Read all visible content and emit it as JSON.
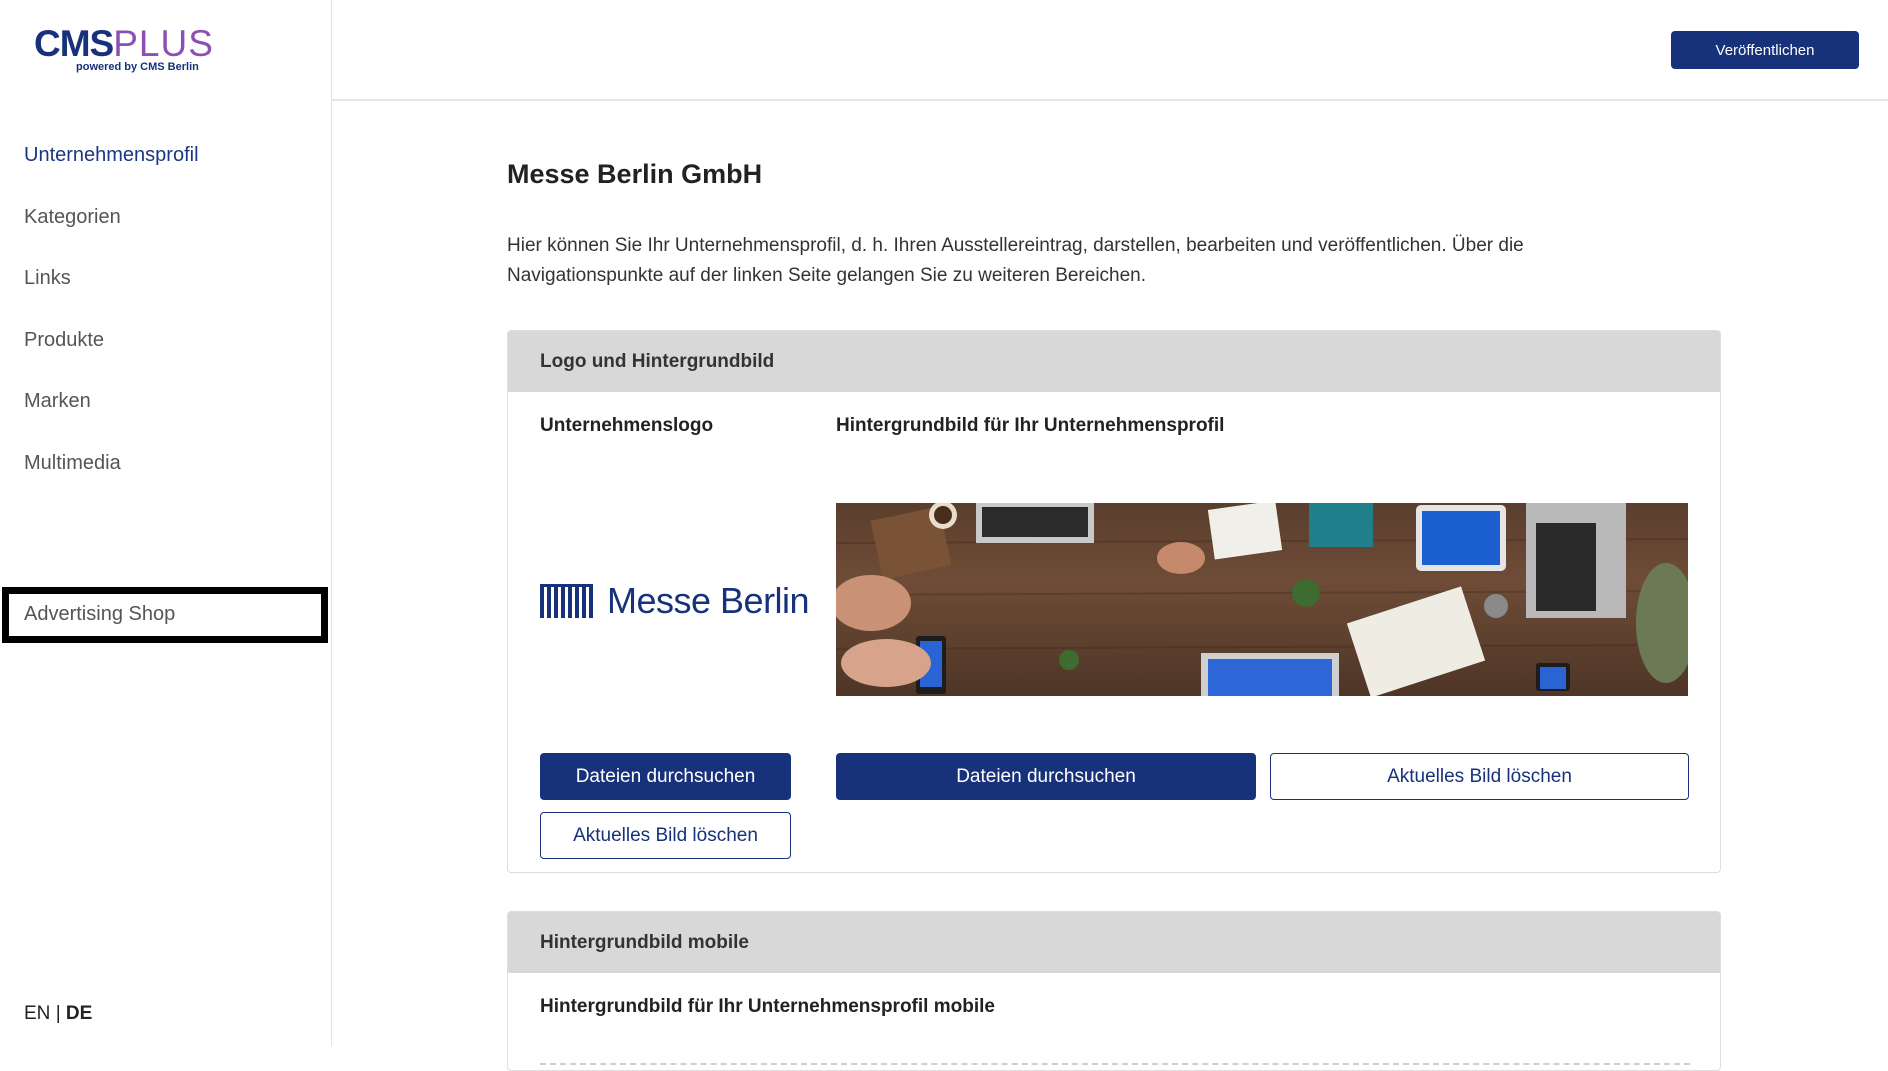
{
  "sidebar": {
    "logo": {
      "main": "CMS",
      "accent": "PLUS",
      "sub": "powered by CMS Berlin"
    },
    "nav": [
      {
        "label": "Unternehmensprofil",
        "active": true
      },
      {
        "label": "Kategorien"
      },
      {
        "label": "Links"
      },
      {
        "label": "Produkte"
      },
      {
        "label": "Marken"
      },
      {
        "label": "Multimedia"
      }
    ],
    "advertising_shop": "Advertising Shop",
    "lang": {
      "en": "EN",
      "sep": "|",
      "de": "DE"
    }
  },
  "header": {
    "publish_label": "Veröffentlichen"
  },
  "main": {
    "title": "Messe Berlin GmbH",
    "description": "Hier können Sie Ihr Unternehmensprofil, d. h. Ihren Ausstellereintrag,  darstellen, bearbeiten und veröffentlichen. Über die Navigationspunkte auf der linken Seite gelangen Sie zu weiteren Bereichen.",
    "card_logo": {
      "heading": "Logo und Hintergrundbild",
      "logo_label": "Unternehmenslogo",
      "logo_text": "Messe Berlin",
      "bg_label": "Hintergrundbild für Ihr Unternehmensprofil",
      "browse_label": "Dateien durchsuchen",
      "delete_label": "Aktuelles Bild löschen"
    },
    "card_mobile": {
      "heading": "Hintergrundbild mobile",
      "label": "Hintergrundbild für Ihr Unternehmensprofil mobile"
    }
  },
  "colors": {
    "brand": "#17327a",
    "accent": "#8e4fb5",
    "panel_header": "#d8d8d8"
  }
}
